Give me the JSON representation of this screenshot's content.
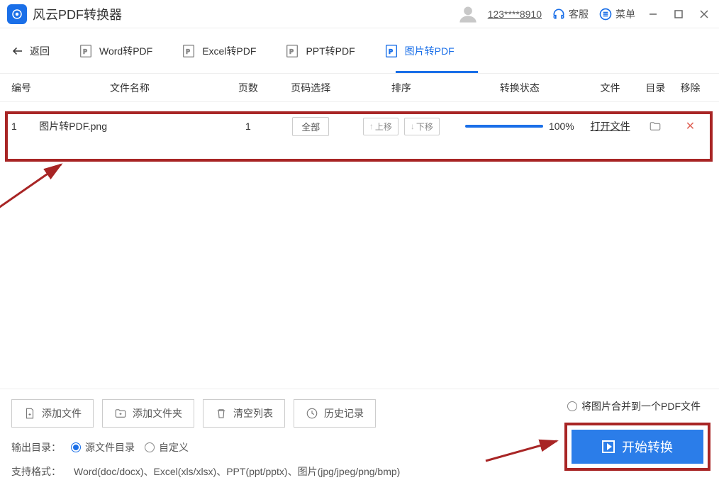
{
  "app": {
    "title": "风云PDF转换器"
  },
  "titlebar": {
    "user": "123****8910",
    "support": "客服",
    "menu": "菜单"
  },
  "back_label": "返回",
  "tabs": [
    {
      "label": "Word转PDF"
    },
    {
      "label": "Excel转PDF"
    },
    {
      "label": "PPT转PDF"
    },
    {
      "label": "图片转PDF"
    }
  ],
  "columns": {
    "num": "编号",
    "name": "文件名称",
    "pages": "页数",
    "pagesel": "页码选择",
    "order": "排序",
    "status": "转换状态",
    "file": "文件",
    "dir": "目录",
    "remove": "移除"
  },
  "rows": [
    {
      "num": "1",
      "name": "图片转PDF.png",
      "pages": "1",
      "pagesel_btn": "全部",
      "up_label": "上移",
      "down_label": "下移",
      "progress_pct": "100%",
      "open_file": "打开文件"
    }
  ],
  "bottom_buttons": {
    "add_file": "添加文件",
    "add_folder": "添加文件夹",
    "clear": "清空列表",
    "history": "历史记录"
  },
  "merge_option": "将图片合并到一个PDF文件",
  "output": {
    "label": "输出目录：",
    "opt_source": "源文件目录",
    "opt_custom": "自定义"
  },
  "support": {
    "label": "支持格式：",
    "text": "Word(doc/docx)、Excel(xls/xlsx)、PPT(ppt/pptx)、图片(jpg/jpeg/png/bmp)"
  },
  "start_label": "开始转换"
}
